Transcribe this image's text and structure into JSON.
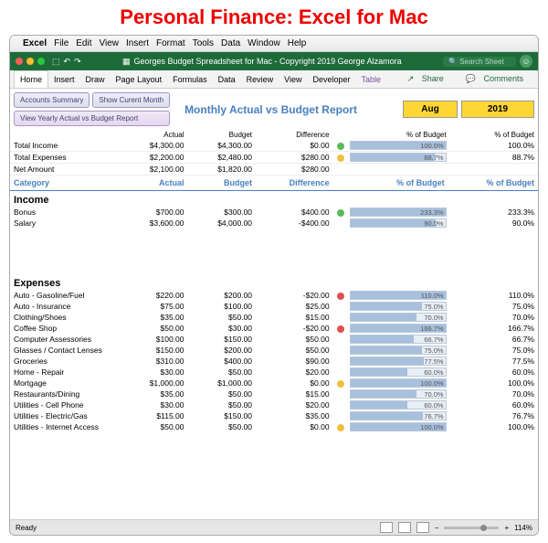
{
  "page_title": "Personal Finance: Excel for Mac",
  "mac_menu": [
    "Excel",
    "File",
    "Edit",
    "View",
    "Insert",
    "Format",
    "Tools",
    "Data",
    "Window",
    "Help"
  ],
  "window_title": "Georges Budget Spreadsheet for Mac - Copyright 2019 George Alzamora",
  "search_placeholder": "Search Sheet",
  "ribbon": [
    "Home",
    "Insert",
    "Draw",
    "Page Layout",
    "Formulas",
    "Data",
    "Review",
    "View",
    "Developer",
    "Table"
  ],
  "share": "Share",
  "comments": "Comments",
  "btn_accounts": "Accounts Summary",
  "btn_current": "Show Curent Month",
  "btn_yearly": "View Yearly Actual vs Budget Report",
  "report_title": "Monthly Actual vs Budget Report",
  "month": "Aug",
  "year": "2019",
  "cols": {
    "actual": "Actual",
    "budget": "Budget",
    "diff": "Difference",
    "pob1": "% of Budget",
    "pob2": "% of Budget"
  },
  "summary": [
    {
      "label": "Total Income",
      "actual": "$4,300.00",
      "budget": "$4,300.00",
      "diff": "$0.00",
      "ind": "g",
      "pct": 100.0,
      "pctt": "100.0%",
      "pct2": "100.0%"
    },
    {
      "label": "Total Expenses",
      "actual": "$2,200.00",
      "budget": "$2,480.00",
      "diff": "$280.00",
      "ind": "y",
      "pct": 88.7,
      "pctt": "88.7%",
      "pct2": "88.7%"
    },
    {
      "label": "Net Amount",
      "actual": "$2,100.00",
      "budget": "$1,820.00",
      "diff": "$280.00"
    }
  ],
  "cat_hdr": {
    "category": "Category",
    "actual": "Actual",
    "budget": "Budget",
    "diff": "Difference",
    "pob1": "% of Budget",
    "pob2": "% of Budget"
  },
  "income_title": "Income",
  "income": [
    {
      "label": "Bonus",
      "actual": "$700.00",
      "budget": "$300.00",
      "diff": "$400.00",
      "ind": "g",
      "pct": 233.3,
      "pctt": "233.3%",
      "pct2": "233.3%"
    },
    {
      "label": "Salary",
      "actual": "$3,600.00",
      "budget": "$4,000.00",
      "diff": "-$400.00",
      "pct": 90.0,
      "pctt": "90.0%",
      "pct2": "90.0%"
    }
  ],
  "expenses_title": "Expenses",
  "expenses": [
    {
      "label": "Auto - Gasoline/Fuel",
      "actual": "$220.00",
      "budget": "$200.00",
      "diff": "-$20.00",
      "ind": "r",
      "pct": 110.0,
      "pctt": "110.0%",
      "pct2": "110.0%"
    },
    {
      "label": "Auto - Insurance",
      "actual": "$75.00",
      "budget": "$100.00",
      "diff": "$25.00",
      "pct": 75.0,
      "pctt": "75.0%",
      "pct2": "75.0%"
    },
    {
      "label": "Clothing/Shoes",
      "actual": "$35.00",
      "budget": "$50.00",
      "diff": "$15.00",
      "pct": 70.0,
      "pctt": "70.0%",
      "pct2": "70.0%"
    },
    {
      "label": "Coffee Shop",
      "actual": "$50.00",
      "budget": "$30.00",
      "diff": "-$20.00",
      "ind": "r",
      "pct": 166.7,
      "pctt": "166.7%",
      "pct2": "166.7%"
    },
    {
      "label": "Computer Assessories",
      "actual": "$100.00",
      "budget": "$150.00",
      "diff": "$50.00",
      "pct": 66.7,
      "pctt": "66.7%",
      "pct2": "66.7%"
    },
    {
      "label": "Glasses / Contact Lenses",
      "actual": "$150.00",
      "budget": "$200.00",
      "diff": "$50.00",
      "pct": 75.0,
      "pctt": "75.0%",
      "pct2": "75.0%"
    },
    {
      "label": "Groceries",
      "actual": "$310.00",
      "budget": "$400.00",
      "diff": "$90.00",
      "pct": 77.5,
      "pctt": "77.5%",
      "pct2": "77.5%"
    },
    {
      "label": "Home - Repair",
      "actual": "$30.00",
      "budget": "$50.00",
      "diff": "$20.00",
      "pct": 60.0,
      "pctt": "60.0%",
      "pct2": "60.0%"
    },
    {
      "label": "Mortgage",
      "actual": "$1,000.00",
      "budget": "$1,000.00",
      "diff": "$0.00",
      "ind": "y",
      "pct": 100.0,
      "pctt": "100.0%",
      "pct2": "100.0%"
    },
    {
      "label": "Restaurants/Dining",
      "actual": "$35.00",
      "budget": "$50.00",
      "diff": "$15.00",
      "pct": 70.0,
      "pctt": "70.0%",
      "pct2": "70.0%"
    },
    {
      "label": "Utilities - Cell Phone",
      "actual": "$30.00",
      "budget": "$50.00",
      "diff": "$20.00",
      "pct": 60.0,
      "pctt": "60.0%",
      "pct2": "60.0%"
    },
    {
      "label": "Utilities - Electric/Gas",
      "actual": "$115.00",
      "budget": "$150.00",
      "diff": "$35.00",
      "pct": 76.7,
      "pctt": "76.7%",
      "pct2": "76.7%"
    },
    {
      "label": "Utilities - Internet Access",
      "actual": "$50.00",
      "budget": "$50.00",
      "diff": "$0.00",
      "ind": "y",
      "pct": 100.0,
      "pctt": "100.0%",
      "pct2": "100.0%"
    }
  ],
  "status_ready": "Ready",
  "zoom": "114%"
}
